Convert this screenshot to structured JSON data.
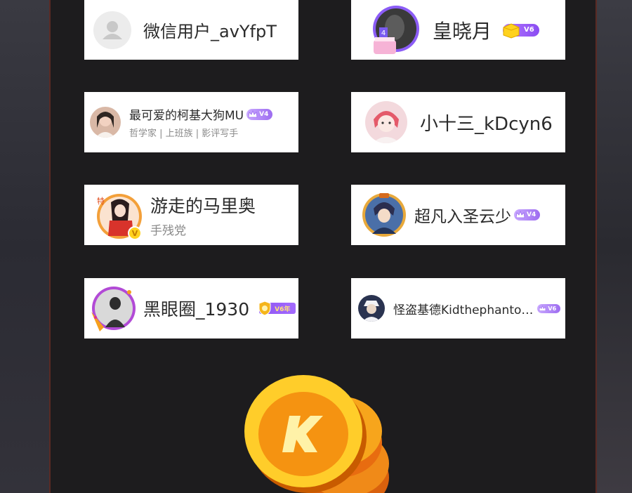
{
  "users": [
    {
      "name": "微信用户_avYfpT",
      "subtitle": "",
      "badge": ""
    },
    {
      "name": "皇晓月",
      "subtitle": "",
      "badge": "V6"
    },
    {
      "name": "最可爱的柯基大狗MU",
      "subtitle": "哲学家 | 上班族 | 影评写手",
      "badge": "V4"
    },
    {
      "name": "小十三_kDcyn6",
      "subtitle": "",
      "badge": ""
    },
    {
      "name": "游走的马里奥",
      "subtitle": "手残党",
      "badge": ""
    },
    {
      "name": "超凡入圣云少",
      "subtitle": "",
      "badge": "V4"
    },
    {
      "name": "黑眼圈_1930",
      "subtitle": "",
      "badge": "V6年"
    },
    {
      "name": "怪盗基德Kidthephanto…",
      "subtitle": "",
      "badge": "V6"
    }
  ],
  "colors": {
    "panel": "#1d1c1e",
    "border_accent": "#5a2a24",
    "badge_purple": "#9d6cf0",
    "coin_gold": "#f7a51c"
  },
  "icons": [
    "default-avatar-icon",
    "crown-icon",
    "yellow-cube-icon",
    "shield-icon",
    "k-coin-icon"
  ]
}
